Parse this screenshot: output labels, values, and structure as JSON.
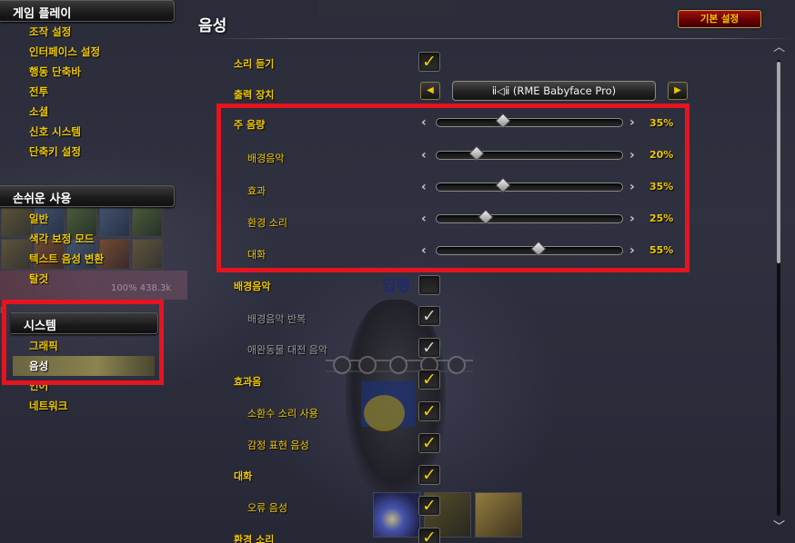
{
  "sidebar": {
    "gameplay": {
      "header": "게임 플레이",
      "items": [
        "조작 설정",
        "인터페이스 설정",
        "행동 단축바",
        "전투",
        "소셜",
        "신호 시스템",
        "단축키 설정"
      ]
    },
    "accessibility": {
      "header": "손쉬운 사용",
      "items": [
        "일반",
        "색각 보정 모드",
        "텍스트 음성 변환",
        "탈것"
      ]
    },
    "system": {
      "header": "시스템",
      "items": [
        "그래픽",
        "음성",
        "언어",
        "네트워크"
      ],
      "selected": "음성"
    }
  },
  "background": {
    "unit_frame_text": "100% 438.3k",
    "nameplate": "입행",
    "left_fragment": "k"
  },
  "main": {
    "title": "음성",
    "defaults_button": "기본 설정",
    "rows": {
      "enable_sound": {
        "label": "소리 듣기",
        "checked": true
      },
      "output_device": {
        "label": "출력 장치",
        "value": "ⅱ◁ⅱ (RME Babyface Pro)"
      },
      "music": {
        "label": "배경음악",
        "checked": false
      },
      "loop_music": {
        "label": "배경음악 반복",
        "checked": true
      },
      "pet_battle_music": {
        "label": "애완동물 대전 음악",
        "checked": true
      },
      "sound_effects": {
        "label": "효과음",
        "checked": true
      },
      "pet_sounds": {
        "label": "소환수 소리 사용",
        "checked": true
      },
      "emote_sounds": {
        "label": "감정 표현 음성",
        "checked": true
      },
      "dialog": {
        "label": "대화",
        "checked": true
      },
      "error_sounds": {
        "label": "오류 음성",
        "checked": true
      },
      "ambience": {
        "label": "환경 소리",
        "checked": true
      }
    },
    "volume": {
      "master": {
        "label": "주 음량",
        "value": "35%",
        "level": 0.35
      },
      "music": {
        "label": "배경음악",
        "value": "20%",
        "level": 0.2
      },
      "effects": {
        "label": "효과",
        "value": "35%",
        "level": 0.35
      },
      "ambience": {
        "label": "환경 소리",
        "value": "25%",
        "level": 0.25
      },
      "dialog": {
        "label": "대화",
        "value": "55%",
        "level": 0.55
      }
    }
  },
  "icons": {
    "check": "✓",
    "arrow_left": "◀",
    "arrow_right": "▶",
    "chevron_left": "‹",
    "chevron_right": "›",
    "scroll_up": "︿",
    "scroll_down": "﹀"
  },
  "colors": {
    "label_gold": "#f0c800",
    "highlight_red": "#e4151f",
    "selected_bar": "#8a8450"
  }
}
